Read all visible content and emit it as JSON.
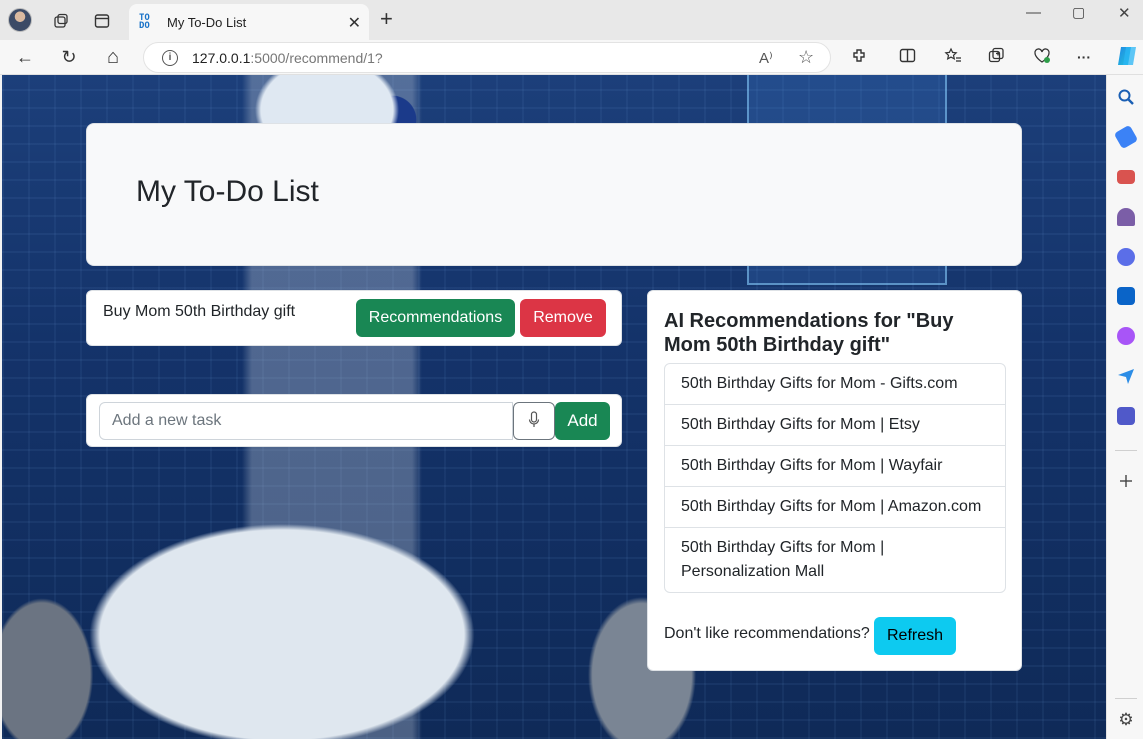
{
  "browser": {
    "tab_title": "My To-Do List",
    "tab_favicon_text": "TO DO",
    "new_tab_symbol": "+",
    "url_host": "127.0.0.1",
    "url_rest": ":5000/recommend/1?",
    "info_symbol": "i",
    "read_aloud_symbol": "A⁾",
    "favorite_symbol": "☆",
    "window_minimize": "—",
    "window_maximize": "▢",
    "window_close": "✕",
    "tab_close": "✕",
    "back_symbol": "←",
    "reload_symbol": "↻",
    "home_symbol": "⌂",
    "more_symbol": "···",
    "settings_symbol": "⚙"
  },
  "page": {
    "title": "My To-Do List",
    "task": {
      "text": "Buy Mom 50th Birthday gift",
      "recommend_label": "Recommendations",
      "remove_label": "Remove"
    },
    "add_form": {
      "placeholder": "Add a new task",
      "add_label": "Add",
      "mic_icon": "microphone-icon"
    },
    "recommendations": {
      "title": "AI Recommendations for \"Buy Mom 50th Birthday gift\"",
      "items": [
        "50th Birthday Gifts for Mom - Gifts.com",
        "50th Birthday Gifts for Mom | Etsy",
        "50th Birthday Gifts for Mom | Wayfair",
        "50th Birthday Gifts for Mom | Amazon.com",
        "50th Birthday Gifts for Mom | Personalization Mall"
      ],
      "dislike_text": "Don't like recommendations?",
      "refresh_label": "Refresh"
    }
  },
  "colors": {
    "success": "#198754",
    "danger": "#dc3545",
    "info": "#0dcaf0"
  }
}
